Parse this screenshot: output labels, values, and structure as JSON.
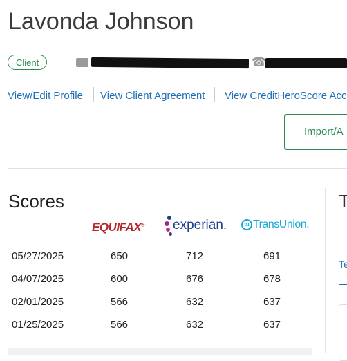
{
  "client": {
    "name": "Lavonda Johnson",
    "badge": "Client",
    "email_redacted": "",
    "phone_redacted": ""
  },
  "links": [
    {
      "label": "View/Edit Profile"
    },
    {
      "label": "View Client Agreement"
    },
    {
      "label": "View CreditHeroScore Acc"
    }
  ],
  "import_button": {
    "label": "Import/A"
  },
  "scores": {
    "title": "Scores",
    "bureaus": {
      "equifax": "EQUIFAX",
      "experian": "experian.",
      "transunion": "TransUnion."
    },
    "rows": [
      {
        "date": "05/27/2025",
        "equifax": "650",
        "experian": "712",
        "transunion": "691"
      },
      {
        "date": "04/07/2025",
        "equifax": "600",
        "experian": "676",
        "transunion": "678"
      },
      {
        "date": "02/01/2025",
        "equifax": "566",
        "experian": "632",
        "transunion": "637"
      },
      {
        "date": "01/25/2025",
        "equifax": "566",
        "experian": "632",
        "transunion": "637"
      }
    ]
  },
  "side_panel": {
    "title_fragment": "T",
    "tab_fragment": "Te"
  },
  "colors": {
    "accent_green": "#2e8b57",
    "link_blue": "#1e6fb8",
    "equifax_red": "#b5262e",
    "experian_blue": "#1d3f8f",
    "transunion_cyan": "#17a8d4"
  }
}
